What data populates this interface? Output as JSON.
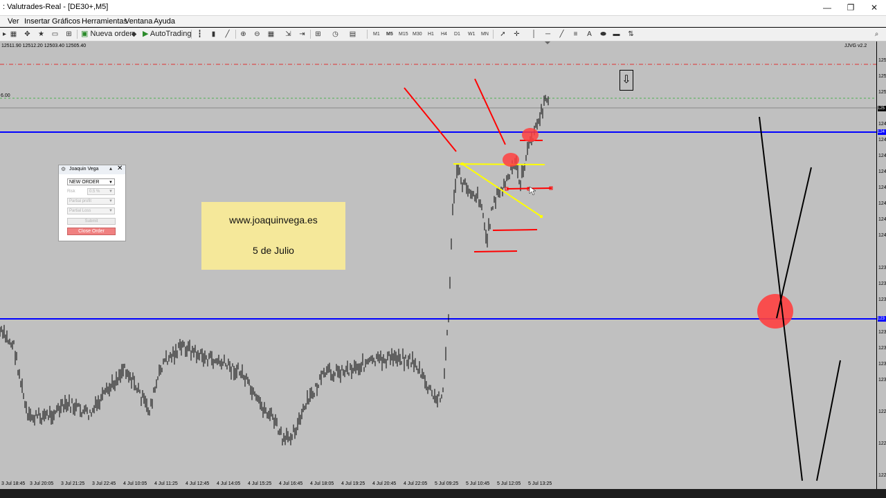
{
  "window": {
    "title": ": Valutrades-Real - [DE30+,M5]",
    "minimize": "—",
    "restore": "❐",
    "close": "✕"
  },
  "menu": [
    "Ver",
    "Insertar",
    "Gráficos",
    "Herramientas",
    "Ventana",
    "Ayuda"
  ],
  "toolbar": {
    "new_order": "Nueva orden",
    "auto_trading": "AutoTrading",
    "timeframes": [
      "M1",
      "M5",
      "M15",
      "M30",
      "H1",
      "H4",
      "D1",
      "W1",
      "MN"
    ],
    "active_timeframe": "M5"
  },
  "chart": {
    "ohlc": "12511.90 12512.20 12503.40 12505.40",
    "ea_label": "JJVG v2.2",
    "level_label": "6.00",
    "note_line1": "www.joaquinvega.es",
    "note_line2": "5 de Julio",
    "x_ticks": [
      "3 Jul 18:45",
      "3 Jul 20:05",
      "3 Jul 21:25",
      "3 Jul 22:45",
      "4 Jul 10:05",
      "4 Jul 11:25",
      "4 Jul 12:45",
      "4 Jul 14:05",
      "4 Jul 15:25",
      "4 Jul 16:45",
      "4 Jul 18:05",
      "4 Jul 19:25",
      "4 Jul 20:45",
      "4 Jul 22:05",
      "5 Jul 09:25",
      "5 Jul 10:45",
      "5 Jul 12:05",
      "5 Jul 13:25"
    ],
    "y_ticks": [
      "125",
      "125",
      "125",
      "124",
      "124",
      "124",
      "124",
      "124",
      "124",
      "124",
      "124",
      "123",
      "123",
      "123",
      "123",
      "123",
      "123",
      "123",
      "122",
      "122",
      "122"
    ],
    "price_badge": "125",
    "blue_badge_top": "124",
    "blue_badge_bottom": "123",
    "colors": {
      "background": "#c0c0c0",
      "candles": "#000000",
      "horizontal_lines": "#0000ff",
      "annotations_red": "#ff0000",
      "annotations_yellow": "#ffff00"
    }
  },
  "panel": {
    "title": "Joaquin Vega",
    "order_type": "NEW ORDER",
    "risk_label": "Risk",
    "risk_value": "0.5 %",
    "partial_profit": "Partial profit",
    "partial_loss": "Partial Loss",
    "submit": "Submit",
    "close_order": "Close Order"
  }
}
